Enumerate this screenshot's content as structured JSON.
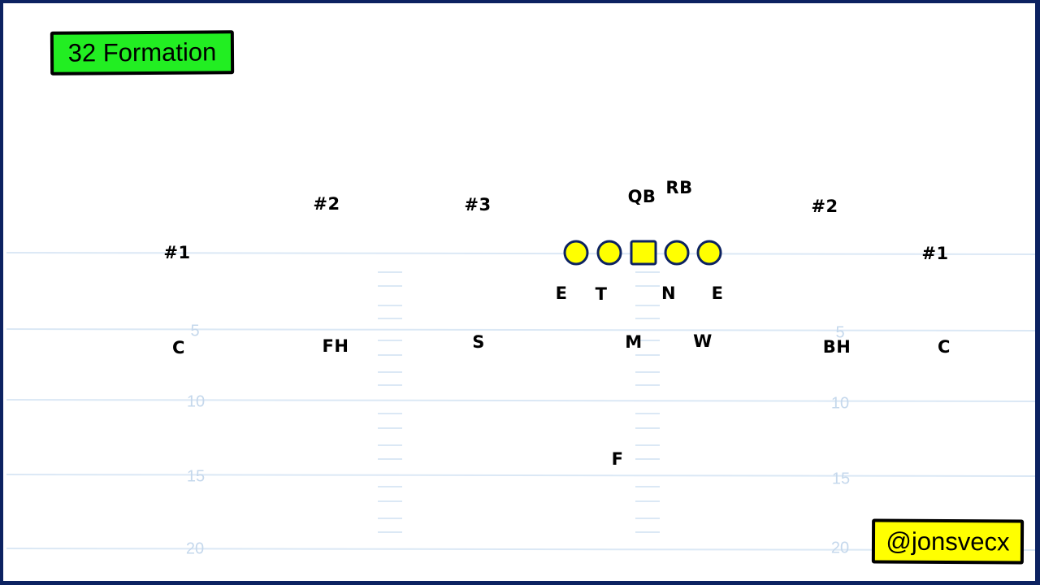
{
  "title": "32 Formation",
  "handle": "@jonsvecx",
  "colors": {
    "border": "#0c2261",
    "title_bg": "#22ee22",
    "handle_bg": "#ffff00",
    "lineman_fill": "#ffff00",
    "lineman_stroke": "#0c2261",
    "yard_line": "#dbe8f5",
    "yard_number": "#c5d8ec"
  },
  "yard_markers": {
    "left": [
      "5",
      "10",
      "15",
      "20"
    ],
    "right": [
      "5",
      "10",
      "15",
      "20"
    ]
  },
  "offense": {
    "labels": [
      "#1",
      "#2",
      "#3",
      "QB",
      "RB",
      "#2",
      "#1"
    ],
    "line": [
      "tackle",
      "guard",
      "center",
      "guard",
      "tackle"
    ]
  },
  "defense": {
    "front": [
      "E",
      "T",
      "N",
      "E"
    ],
    "second_level": [
      "C",
      "FH",
      "S",
      "M",
      "W",
      "BH",
      "C"
    ],
    "deep": [
      "F"
    ]
  }
}
